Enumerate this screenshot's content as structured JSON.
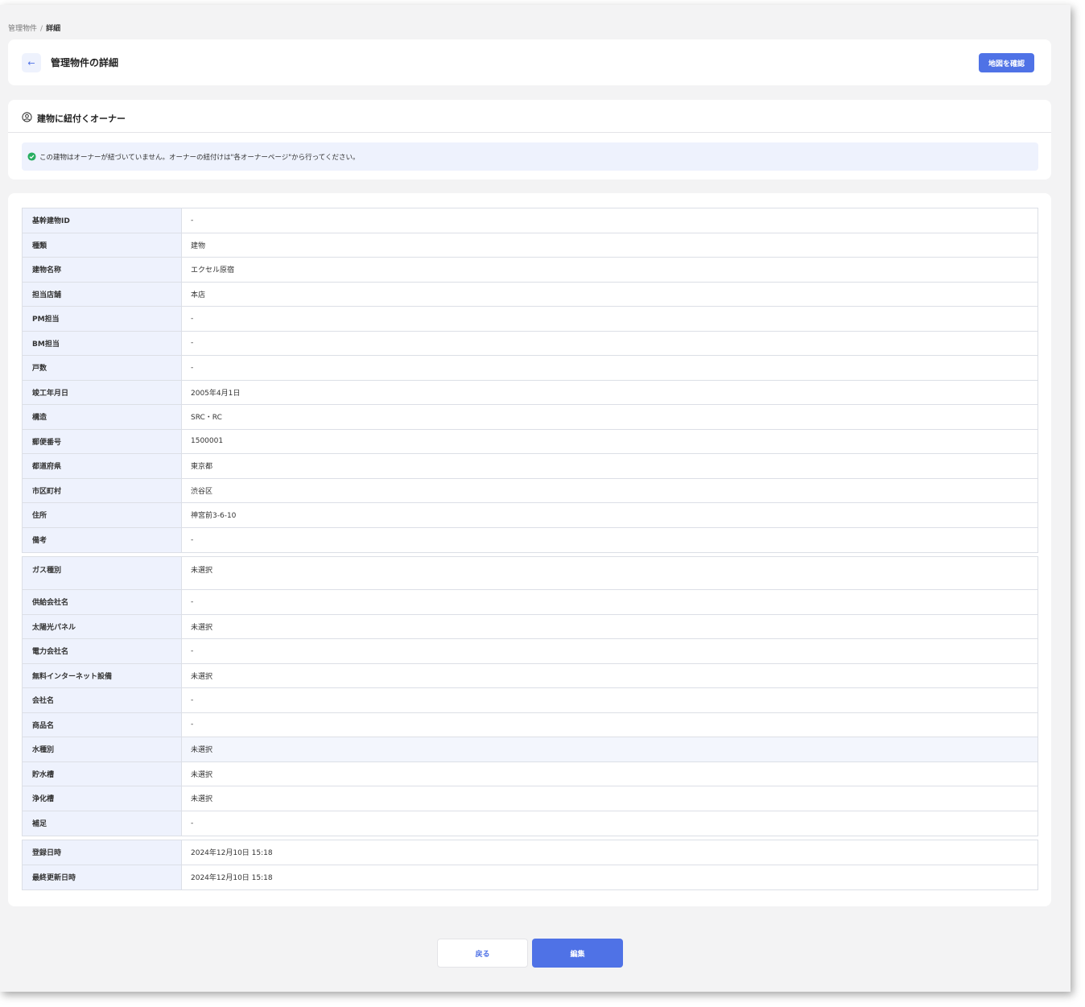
{
  "breadcrumb": {
    "parent": "管理物件",
    "separator": "/",
    "current": "詳細"
  },
  "header": {
    "title": "管理物件の詳細",
    "back_icon": "arrow-left-icon",
    "map_button": "地図を確認"
  },
  "owner_section": {
    "title": "建物に紐付くオーナー",
    "icon": "user-circle-icon",
    "info_icon": "check-circle-icon",
    "info_text": "この建物はオーナーが紐づいていません。オーナーの紐付けは\"各オーナーページ\"から行ってください。"
  },
  "building_info": [
    {
      "label": "基幹建物ID",
      "value": "-"
    },
    {
      "label": "種類",
      "value": "建物"
    },
    {
      "label": "建物名称",
      "value": "エクセル原宿"
    },
    {
      "label": "担当店舗",
      "value": "本店"
    },
    {
      "label": "PM担当",
      "value": "-"
    },
    {
      "label": "BM担当",
      "value": "-"
    },
    {
      "label": "戸数",
      "value": "-"
    },
    {
      "label": "竣工年月日",
      "value": "2005年4月1日"
    },
    {
      "label": "構造",
      "value": "SRC・RC"
    },
    {
      "label": "郵便番号",
      "value": "1500001"
    },
    {
      "label": "都道府県",
      "value": "東京都"
    },
    {
      "label": "市区町村",
      "value": "渋谷区"
    },
    {
      "label": "住所",
      "value": "神宮前3-6-10"
    },
    {
      "label": "備考",
      "value": "-"
    }
  ],
  "facility_info": [
    {
      "label": "ガス種別",
      "value": "未選択"
    },
    {
      "label": "供給会社名",
      "value": "-"
    },
    {
      "label": "太陽光パネル",
      "value": "未選択"
    },
    {
      "label": "電力会社名",
      "value": "-"
    },
    {
      "label": "無料インターネット設備",
      "value": "未選択"
    },
    {
      "label": "会社名",
      "value": "-"
    },
    {
      "label": "商品名",
      "value": "-"
    },
    {
      "label": "水種別",
      "value": "未選択"
    },
    {
      "label": "貯水槽",
      "value": "未選択"
    },
    {
      "label": "浄化槽",
      "value": "未選択"
    },
    {
      "label": "補足",
      "value": "-"
    }
  ],
  "record_info": [
    {
      "label": "登録日時",
      "value": "2024年12月10日 15:18"
    },
    {
      "label": "最終更新日時",
      "value": "2024年12月10日 15:18"
    }
  ],
  "footer": {
    "back_button": "戻る",
    "edit_button": "編集"
  },
  "colors": {
    "primary": "#4f72e6",
    "label_bg": "#eef2fd",
    "success": "#27ae60"
  }
}
